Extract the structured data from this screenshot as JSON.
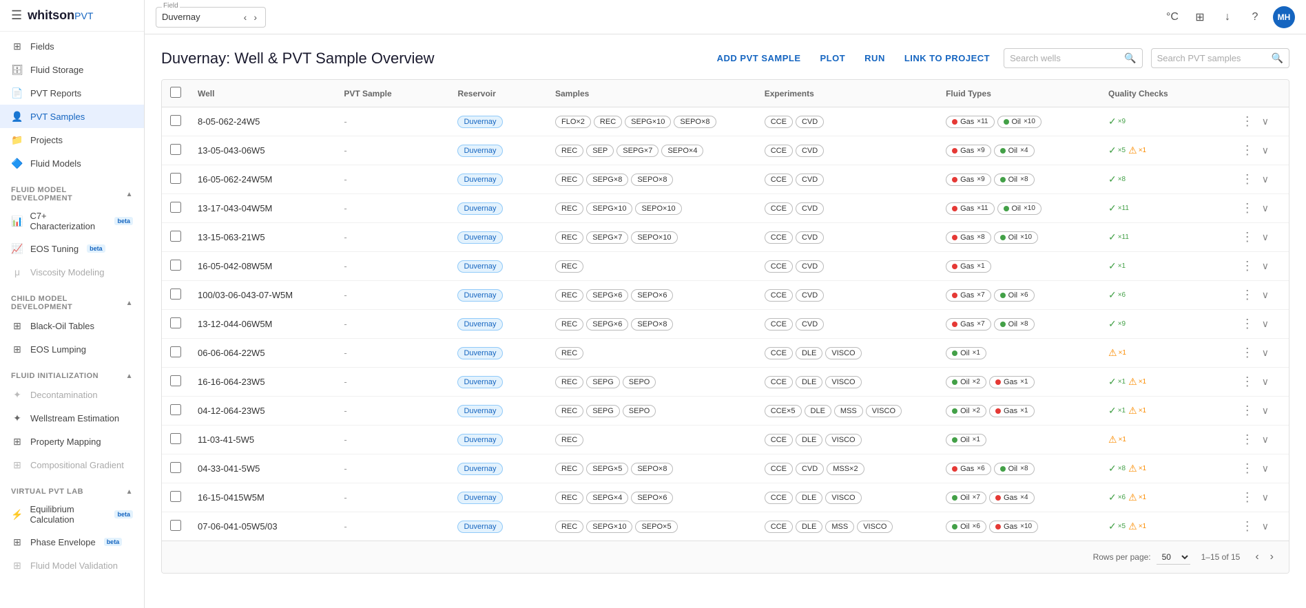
{
  "app": {
    "logo": "whitson",
    "logo_suffix": "PVT",
    "menu_icon": "☰",
    "field_label": "Field",
    "field_value": "Duvernay"
  },
  "topbar_icons": [
    "°C",
    "⊞",
    "↓",
    "?"
  ],
  "avatar": "MH",
  "sidebar": {
    "top_items": [
      {
        "id": "fields",
        "label": "Fields",
        "icon": "⊞"
      },
      {
        "id": "fluid-storage",
        "label": "Fluid Storage",
        "icon": "🗄"
      },
      {
        "id": "pvt-reports",
        "label": "PVT Reports",
        "icon": "📄"
      },
      {
        "id": "pvt-samples",
        "label": "PVT Samples",
        "icon": "👤",
        "active": true
      },
      {
        "id": "projects",
        "label": "Projects",
        "icon": "📁"
      },
      {
        "id": "fluid-models",
        "label": "Fluid Models",
        "icon": "🔷"
      }
    ],
    "sections": [
      {
        "id": "fluid-model-dev",
        "label": "Fluid Model Development",
        "expanded": true,
        "items": [
          {
            "id": "c7-char",
            "label": "C7+ Characterization",
            "icon": "📊",
            "badge": "beta"
          },
          {
            "id": "eos-tuning",
            "label": "EOS Tuning",
            "icon": "📈",
            "badge": "beta"
          },
          {
            "id": "viscosity",
            "label": "Viscosity Modeling",
            "icon": "μ",
            "disabled": true
          }
        ]
      },
      {
        "id": "child-model-dev",
        "label": "Child Model Development",
        "expanded": true,
        "items": [
          {
            "id": "black-oil",
            "label": "Black-Oil Tables",
            "icon": "⊞"
          },
          {
            "id": "eos-lumping",
            "label": "EOS Lumping",
            "icon": "⊞"
          }
        ]
      },
      {
        "id": "fluid-init",
        "label": "Fluid Initialization",
        "expanded": true,
        "items": [
          {
            "id": "decontamination",
            "label": "Decontamination",
            "icon": "✦",
            "disabled": true
          },
          {
            "id": "wellstream",
            "label": "Wellstream Estimation",
            "icon": "✦"
          },
          {
            "id": "property-mapping",
            "label": "Property Mapping",
            "icon": "⊞"
          },
          {
            "id": "compositional-gradient",
            "label": "Compositional Gradient",
            "icon": "⊞",
            "disabled": true
          }
        ]
      },
      {
        "id": "virtual-pvt",
        "label": "Virtual PVT Lab",
        "expanded": true,
        "items": [
          {
            "id": "equilibrium",
            "label": "Equilibrium Calculation",
            "icon": "⚡",
            "badge": "beta"
          },
          {
            "id": "phase-envelope",
            "label": "Phase Envelope",
            "icon": "⊞",
            "badge": "beta"
          },
          {
            "id": "fluid-model-val",
            "label": "Fluid Model Validation",
            "icon": "⊞",
            "disabled": true
          }
        ]
      }
    ]
  },
  "page": {
    "title": "Duvernay: Well & PVT Sample Overview",
    "actions": {
      "add_pvt": "ADD PVT SAMPLE",
      "plot": "PLOT",
      "run": "RUN",
      "link_project": "LINK TO PROJECT"
    },
    "search_wells_placeholder": "Search wells",
    "search_pvt_placeholder": "Search PVT samples"
  },
  "table": {
    "headers": [
      "",
      "Well",
      "PVT Sample",
      "Reservoir",
      "Samples",
      "Experiments",
      "Fluid Types",
      "Quality Checks",
      ""
    ],
    "rows": [
      {
        "well": "8-05-062-24W5",
        "pvt_sample": "-",
        "reservoir": "Duvernay",
        "samples": [
          "FLO×2",
          "REC",
          "SEPG×10",
          "SEPO×8"
        ],
        "experiments": [
          "CCE",
          "CVD"
        ],
        "fluid_types": [
          {
            "type": "gas",
            "label": "Gas",
            "count": 11
          },
          {
            "type": "oil",
            "label": "Oil",
            "count": 10
          }
        ],
        "quality": [
          {
            "ok": true,
            "count": 9
          }
        ]
      },
      {
        "well": "13-05-043-06W5",
        "pvt_sample": "-",
        "reservoir": "Duvernay",
        "samples": [
          "REC",
          "SEP",
          "SEPG×7",
          "SEPO×4"
        ],
        "experiments": [
          "CCE",
          "CVD"
        ],
        "fluid_types": [
          {
            "type": "gas",
            "label": "Gas",
            "count": 9
          },
          {
            "type": "oil",
            "label": "Oil",
            "count": 4
          }
        ],
        "quality": [
          {
            "ok": true,
            "count": 5
          },
          {
            "warn": true,
            "count": 1
          }
        ]
      },
      {
        "well": "16-05-062-24W5M",
        "pvt_sample": "-",
        "reservoir": "Duvernay",
        "samples": [
          "REC",
          "SEPG×8",
          "SEPO×8"
        ],
        "experiments": [
          "CCE",
          "CVD"
        ],
        "fluid_types": [
          {
            "type": "gas",
            "label": "Gas",
            "count": 9
          },
          {
            "type": "oil",
            "label": "Oil",
            "count": 8
          }
        ],
        "quality": [
          {
            "ok": true,
            "count": 8
          }
        ]
      },
      {
        "well": "13-17-043-04W5M",
        "pvt_sample": "-",
        "reservoir": "Duvernay",
        "samples": [
          "REC",
          "SEPG×10",
          "SEPO×10"
        ],
        "experiments": [
          "CCE",
          "CVD"
        ],
        "fluid_types": [
          {
            "type": "gas",
            "label": "Gas",
            "count": 11
          },
          {
            "type": "oil",
            "label": "Oil",
            "count": 10
          }
        ],
        "quality": [
          {
            "ok": true,
            "count": 11
          }
        ]
      },
      {
        "well": "13-15-063-21W5",
        "pvt_sample": "-",
        "reservoir": "Duvernay",
        "samples": [
          "REC",
          "SEPG×7",
          "SEPO×10"
        ],
        "experiments": [
          "CCE",
          "CVD"
        ],
        "fluid_types": [
          {
            "type": "gas",
            "label": "Gas",
            "count": 8
          },
          {
            "type": "oil",
            "label": "Oil",
            "count": 10
          }
        ],
        "quality": [
          {
            "ok": true,
            "count": 11
          }
        ]
      },
      {
        "well": "16-05-042-08W5M",
        "pvt_sample": "-",
        "reservoir": "Duvernay",
        "samples": [
          "REC"
        ],
        "experiments": [
          "CCE",
          "CVD"
        ],
        "fluid_types": [
          {
            "type": "gas",
            "label": "Gas",
            "count": 1
          }
        ],
        "quality": [
          {
            "ok": true,
            "count": 1
          }
        ]
      },
      {
        "well": "100/03-06-043-07-W5M",
        "pvt_sample": "-",
        "reservoir": "Duvernay",
        "samples": [
          "REC",
          "SEPG×6",
          "SEPO×6"
        ],
        "experiments": [
          "CCE",
          "CVD"
        ],
        "fluid_types": [
          {
            "type": "gas",
            "label": "Gas",
            "count": 7
          },
          {
            "type": "oil",
            "label": "Oil",
            "count": 6
          }
        ],
        "quality": [
          {
            "ok": true,
            "count": 6
          }
        ]
      },
      {
        "well": "13-12-044-06W5M",
        "pvt_sample": "-",
        "reservoir": "Duvernay",
        "samples": [
          "REC",
          "SEPG×6",
          "SEPO×8"
        ],
        "experiments": [
          "CCE",
          "CVD"
        ],
        "fluid_types": [
          {
            "type": "gas",
            "label": "Gas",
            "count": 7
          },
          {
            "type": "oil",
            "label": "Oil",
            "count": 8
          }
        ],
        "quality": [
          {
            "ok": true,
            "count": 9
          }
        ]
      },
      {
        "well": "06-06-064-22W5",
        "pvt_sample": "-",
        "reservoir": "Duvernay",
        "samples": [
          "REC"
        ],
        "experiments": [
          "CCE",
          "DLE",
          "VISCO"
        ],
        "fluid_types": [
          {
            "type": "oil",
            "label": "Oil",
            "count": 1
          }
        ],
        "quality": [
          {
            "warn": true,
            "count": 1
          }
        ]
      },
      {
        "well": "16-16-064-23W5",
        "pvt_sample": "-",
        "reservoir": "Duvernay",
        "samples": [
          "REC",
          "SEPG",
          "SEPO"
        ],
        "experiments": [
          "CCE",
          "DLE",
          "VISCO"
        ],
        "fluid_types": [
          {
            "type": "oil",
            "label": "Oil",
            "count": 2
          },
          {
            "type": "gas",
            "label": "Gas",
            "count": 1
          }
        ],
        "quality": [
          {
            "ok": true,
            "count": 1
          },
          {
            "warn": true,
            "count": 1
          }
        ]
      },
      {
        "well": "04-12-064-23W5",
        "pvt_sample": "-",
        "reservoir": "Duvernay",
        "samples": [
          "REC",
          "SEPG",
          "SEPO"
        ],
        "experiments": [
          "CCE×5",
          "DLE",
          "MSS",
          "VISCO"
        ],
        "fluid_types": [
          {
            "type": "oil",
            "label": "Oil",
            "count": 2
          },
          {
            "type": "gas",
            "label": "Gas",
            "count": 1
          }
        ],
        "quality": [
          {
            "ok": true,
            "count": 1
          },
          {
            "warn": true,
            "count": 1
          }
        ]
      },
      {
        "well": "11-03-41-5W5",
        "pvt_sample": "-",
        "reservoir": "Duvernay",
        "samples": [
          "REC"
        ],
        "experiments": [
          "CCE",
          "DLE",
          "VISCO"
        ],
        "fluid_types": [
          {
            "type": "oil",
            "label": "Oil",
            "count": 1
          }
        ],
        "quality": [
          {
            "warn": true,
            "count": 1
          }
        ]
      },
      {
        "well": "04-33-041-5W5",
        "pvt_sample": "-",
        "reservoir": "Duvernay",
        "samples": [
          "REC",
          "SEPG×5",
          "SEPO×8"
        ],
        "experiments": [
          "CCE",
          "CVD",
          "MSS×2"
        ],
        "fluid_types": [
          {
            "type": "gas",
            "label": "Gas",
            "count": 6
          },
          {
            "type": "oil",
            "label": "Oil",
            "count": 8
          }
        ],
        "quality": [
          {
            "ok": true,
            "count": 8
          },
          {
            "warn": true,
            "count": 1
          }
        ]
      },
      {
        "well": "16-15-0415W5M",
        "pvt_sample": "-",
        "reservoir": "Duvernay",
        "samples": [
          "REC",
          "SEPG×4",
          "SEPO×6"
        ],
        "experiments": [
          "CCE",
          "DLE",
          "VISCO"
        ],
        "fluid_types": [
          {
            "type": "oil",
            "label": "Oil",
            "count": 7
          },
          {
            "type": "gas",
            "label": "Gas",
            "count": 4
          }
        ],
        "quality": [
          {
            "ok": true,
            "count": 6
          },
          {
            "warn": true,
            "count": 1
          }
        ]
      },
      {
        "well": "07-06-041-05W5/03",
        "pvt_sample": "-",
        "reservoir": "Duvernay",
        "samples": [
          "REC",
          "SEPG×10",
          "SEPO×5"
        ],
        "experiments": [
          "CCE",
          "DLE",
          "MSS",
          "VISCO"
        ],
        "fluid_types": [
          {
            "type": "oil",
            "label": "Oil",
            "count": 6
          },
          {
            "type": "gas",
            "label": "Gas",
            "count": 10
          }
        ],
        "quality": [
          {
            "ok": true,
            "count": 5
          },
          {
            "warn": true,
            "count": 1
          }
        ]
      }
    ]
  },
  "footer": {
    "rows_per_page_label": "Rows per page:",
    "rows_per_page_value": "50",
    "pagination_info": "1–15 of 15"
  }
}
